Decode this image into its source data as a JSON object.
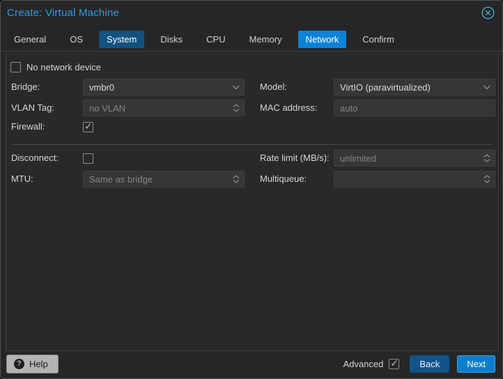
{
  "window": {
    "title": "Create: Virtual Machine"
  },
  "tabs": [
    {
      "label": "General",
      "active": false,
      "visited": false
    },
    {
      "label": "OS",
      "active": false,
      "visited": false
    },
    {
      "label": "System",
      "active": false,
      "visited": true
    },
    {
      "label": "Disks",
      "active": false,
      "visited": false
    },
    {
      "label": "CPU",
      "active": false,
      "visited": false
    },
    {
      "label": "Memory",
      "active": false,
      "visited": false
    },
    {
      "label": "Network",
      "active": true,
      "visited": false
    },
    {
      "label": "Confirm",
      "active": false,
      "visited": false
    }
  ],
  "form": {
    "no_network_device": {
      "label": "No network device",
      "checked": false
    },
    "bridge": {
      "label": "Bridge:",
      "value": "vmbr0"
    },
    "model": {
      "label": "Model:",
      "value": "VirtIO (paravirtualized)"
    },
    "vlan_tag": {
      "label": "VLAN Tag:",
      "placeholder": "no VLAN"
    },
    "mac_address": {
      "label": "MAC address:",
      "placeholder": "auto"
    },
    "firewall": {
      "label": "Firewall:",
      "checked": true
    },
    "disconnect": {
      "label": "Disconnect:",
      "checked": false
    },
    "rate_limit": {
      "label": "Rate limit (MB/s):",
      "placeholder": "unlimited"
    },
    "mtu": {
      "label": "MTU:",
      "placeholder": "Same as bridge"
    },
    "multiqueue": {
      "label": "Multiqueue:",
      "placeholder": ""
    }
  },
  "footer": {
    "help_label": "Help",
    "advanced_label": "Advanced",
    "advanced_checked": true,
    "back_label": "Back",
    "next_label": "Next"
  },
  "colors": {
    "accent_blue": "#0e82d6",
    "tab_visited_blue": "#11527f",
    "back_button_blue": "#12538a",
    "next_button_blue": "#0d7ecd",
    "next_border": "#4ba4de",
    "title_blue": "#2f9be0",
    "close_icon": "#43b3d4",
    "window_border": "#525252"
  }
}
